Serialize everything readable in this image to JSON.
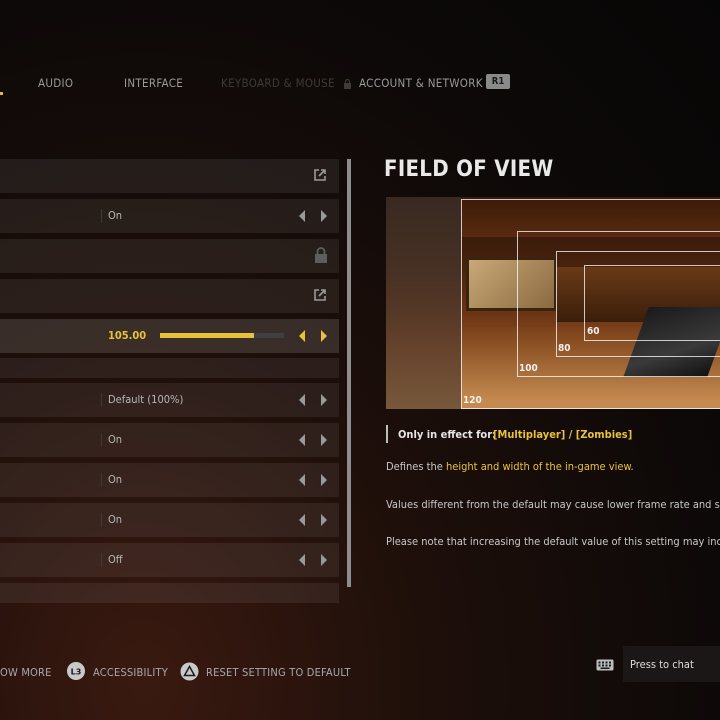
{
  "tabs": [
    {
      "label": "AUDIO",
      "locked": false
    },
    {
      "label": "INTERFACE",
      "locked": false
    },
    {
      "label": "KEYBOARD & MOUSE",
      "locked": true
    },
    {
      "label": "ACCOUNT & NETWORK",
      "locked": false
    }
  ],
  "tab_next_button": "R1",
  "settings_rows": [
    {
      "value": "",
      "control": "external-link"
    },
    {
      "value": "On",
      "control": "arrows"
    },
    {
      "value": "",
      "control": "lock"
    },
    {
      "value": "",
      "control": "external-link"
    },
    {
      "value": "105.00",
      "control": "slider",
      "slider_fraction": 0.76
    },
    {
      "value": "",
      "control": "none"
    },
    {
      "value": "Default (100%)",
      "control": "arrows"
    },
    {
      "value": "On",
      "control": "arrows"
    },
    {
      "value": "On",
      "control": "arrows"
    },
    {
      "value": "On",
      "control": "arrows"
    },
    {
      "value": "Off",
      "control": "arrows"
    }
  ],
  "detail": {
    "title": "FIELD OF VIEW",
    "fov_labels": [
      "120",
      "100",
      "80",
      "60"
    ],
    "only_in_effect_label": "Only in effect for:",
    "only_in_effect_value": "[Multiplayer] / [Zombies]",
    "desc1_prefix": "Defines the ",
    "desc1_highlight": "height and width of the in-game view",
    "desc1_suffix": ".",
    "desc2": "Values different from the default may cause lower frame rate and s",
    "desc3": "Please note that increasing the default value of this setting may inc"
  },
  "bottom_hints": {
    "show_more": "OW MORE",
    "accessibility_button": "L3",
    "accessibility": "ACCESSIBILITY",
    "reset": "RESET SETTING TO DEFAULT",
    "chat": "Press to chat"
  },
  "colors": {
    "accent": "#e8c23a",
    "background": "#0d0908"
  }
}
